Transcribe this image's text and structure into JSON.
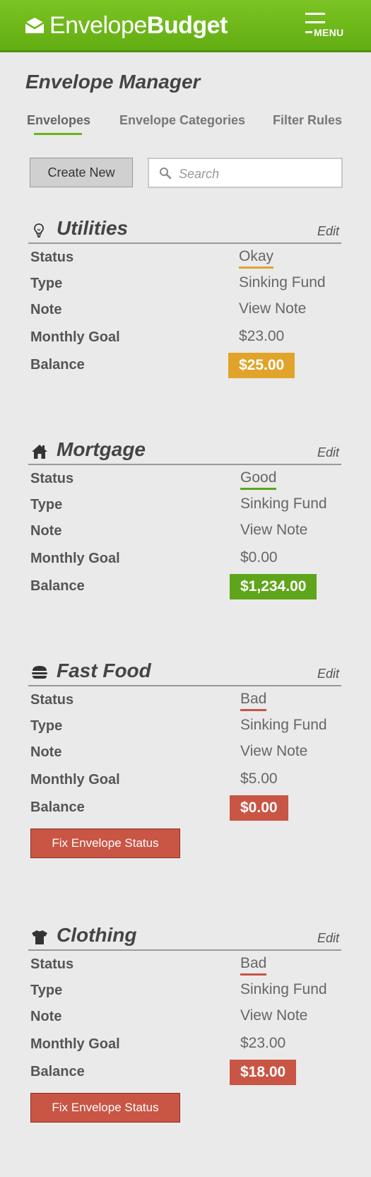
{
  "app": {
    "logo_light": "Envelope",
    "logo_bold": "Budget",
    "menu_label": "MENU"
  },
  "page": {
    "title": "Envelope Manager",
    "tabs": [
      {
        "label": "Envelopes",
        "active": true
      },
      {
        "label": "Envelope Categories",
        "active": false
      },
      {
        "label": "Filter Rules",
        "active": false
      }
    ],
    "create_label": "Create New",
    "search_placeholder": "Search"
  },
  "row_labels": {
    "status": "Status",
    "type": "Type",
    "note": "Note",
    "goal": "Monthly Goal",
    "balance": "Balance"
  },
  "edit_label": "Edit",
  "fix_label": "Fix Envelope Status",
  "colors": {
    "brand_green": "#6bb51a",
    "okay": "#e0a42b",
    "good": "#5ea51c",
    "bad": "#c95545"
  },
  "envelopes": [
    {
      "icon": "lightbulb-icon",
      "name": "Utilities",
      "status": "Okay",
      "status_color": "#e0a42b",
      "type": "Sinking Fund",
      "note": "View Note",
      "goal": "$23.00",
      "balance": "$25.00",
      "balance_color": "#e0a42b",
      "show_fix": false
    },
    {
      "icon": "home-icon",
      "name": "Mortgage",
      "status": "Good",
      "status_color": "#5ea51c",
      "type": "Sinking Fund",
      "note": "View Note",
      "goal": "$0.00",
      "balance": "$1,234.00",
      "balance_color": "#5ea51c",
      "show_fix": false
    },
    {
      "icon": "burger-icon",
      "name": "Fast Food",
      "status": "Bad",
      "status_color": "#c95545",
      "type": "Sinking Fund",
      "note": "View Note",
      "goal": "$5.00",
      "balance": "$0.00",
      "balance_color": "#c95545",
      "show_fix": true
    },
    {
      "icon": "tshirt-icon",
      "name": "Clothing",
      "status": "Bad",
      "status_color": "#c95545",
      "type": "Sinking Fund",
      "note": "View Note",
      "goal": "$23.00",
      "balance": "$18.00",
      "balance_color": "#c95545",
      "show_fix": true
    }
  ]
}
